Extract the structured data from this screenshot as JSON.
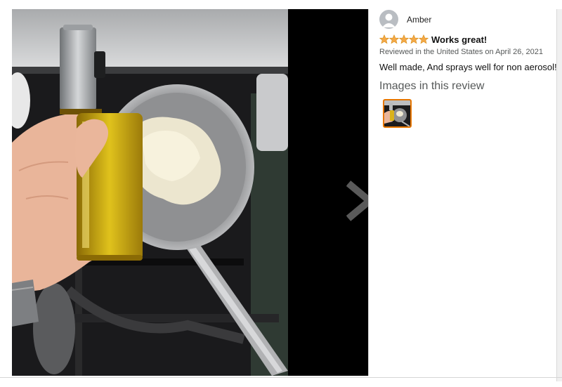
{
  "reviewer": {
    "name": "Amber",
    "avatar_icon": "user-avatar-icon"
  },
  "review": {
    "rating": 5,
    "rating_max": 5,
    "title": "Works great!",
    "date_line": "Reviewed in the United States on April 26, 2021",
    "body": "Well made, And sprays well for non aerosol!"
  },
  "images_section": {
    "heading": "Images in this review"
  },
  "viewer": {
    "next_icon": "chevron-right-icon"
  },
  "colors": {
    "star": "#f3a847",
    "thumb_border": "#e77600",
    "viewer_bg": "#000000"
  }
}
